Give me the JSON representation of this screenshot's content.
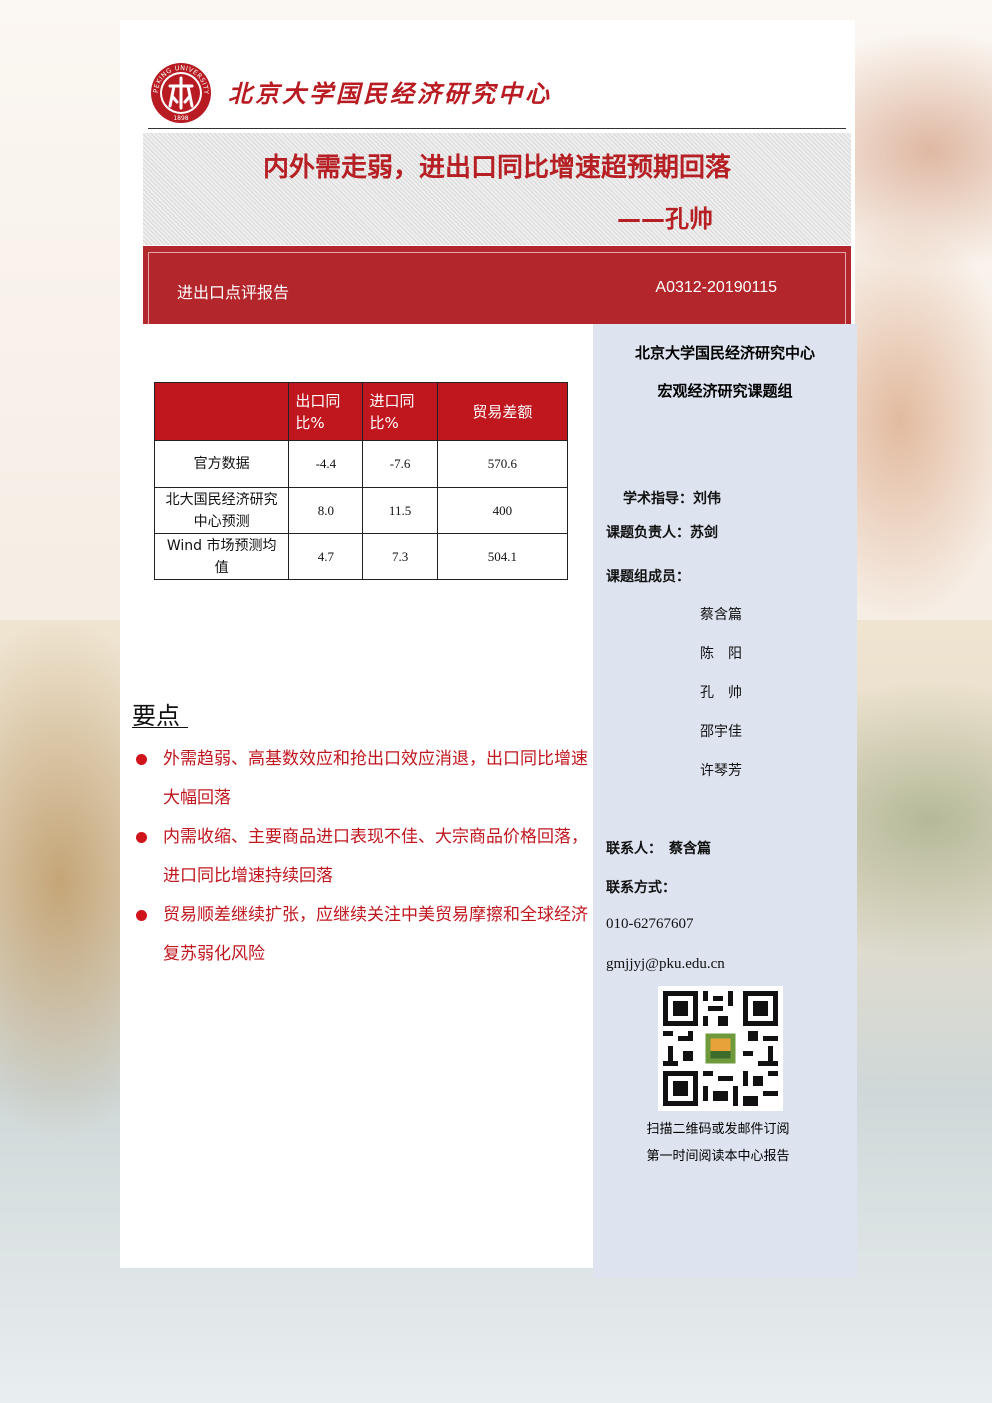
{
  "header": {
    "org_name": "北京大学国民经济研究中心",
    "logo_text_top": "PEKING UNIVERSITY",
    "logo_year": "1898"
  },
  "title": {
    "main": "内外需走弱，进出口同比增速超预期回落",
    "author": "——孔帅"
  },
  "band": {
    "report_type": "进出口点评报告",
    "report_code": "A0312-20190115"
  },
  "table": {
    "headers": [
      "",
      "出口同比%",
      "进口同比%",
      "贸易差额"
    ],
    "rows": [
      [
        "官方数据",
        "-4.4",
        "-7.6",
        "570.6"
      ],
      [
        "北大国民经济研究中心预测",
        "8.0",
        "11.5",
        "400"
      ],
      [
        "Wind 市场预测均值",
        "4.7",
        "7.3",
        "504.1"
      ]
    ]
  },
  "key_points": {
    "title": "要点",
    "items": [
      "外需趋弱、高基数效应和抢出口效应消退，出口同比增速大幅回落",
      "内需收缩、主要商品进口表现不佳、大宗商品价格回落，进口同比增速持续回落",
      "贸易顺差继续扩张，应继续关注中美贸易摩擦和全球经济复苏弱化风险"
    ]
  },
  "sidebar": {
    "org_line1": "北京大学国民经济研究中心",
    "org_line2": "宏观经济研究课题组",
    "advisor": "学术指导：刘伟",
    "lead": "课题负责人：苏剑",
    "members_label": "课题组成员：",
    "members": [
      "蔡含篇",
      "陈　阳",
      "孔　帅",
      "邵宇佳",
      "许琴芳"
    ],
    "contact_person": "联系人：　蔡含篇",
    "contact_method_label": "联系方式：",
    "phone": "010-62767607",
    "email": "gmjjyj@pku.edu.cn",
    "qr_caption_1": "扫描二维码或发邮件订阅",
    "qr_caption_2": "第一时间阅读本中心报告"
  },
  "colors": {
    "brand_red": "#b3262b",
    "sidebar_bg": "#dde3ef",
    "bullet_red": "#d0141c"
  }
}
